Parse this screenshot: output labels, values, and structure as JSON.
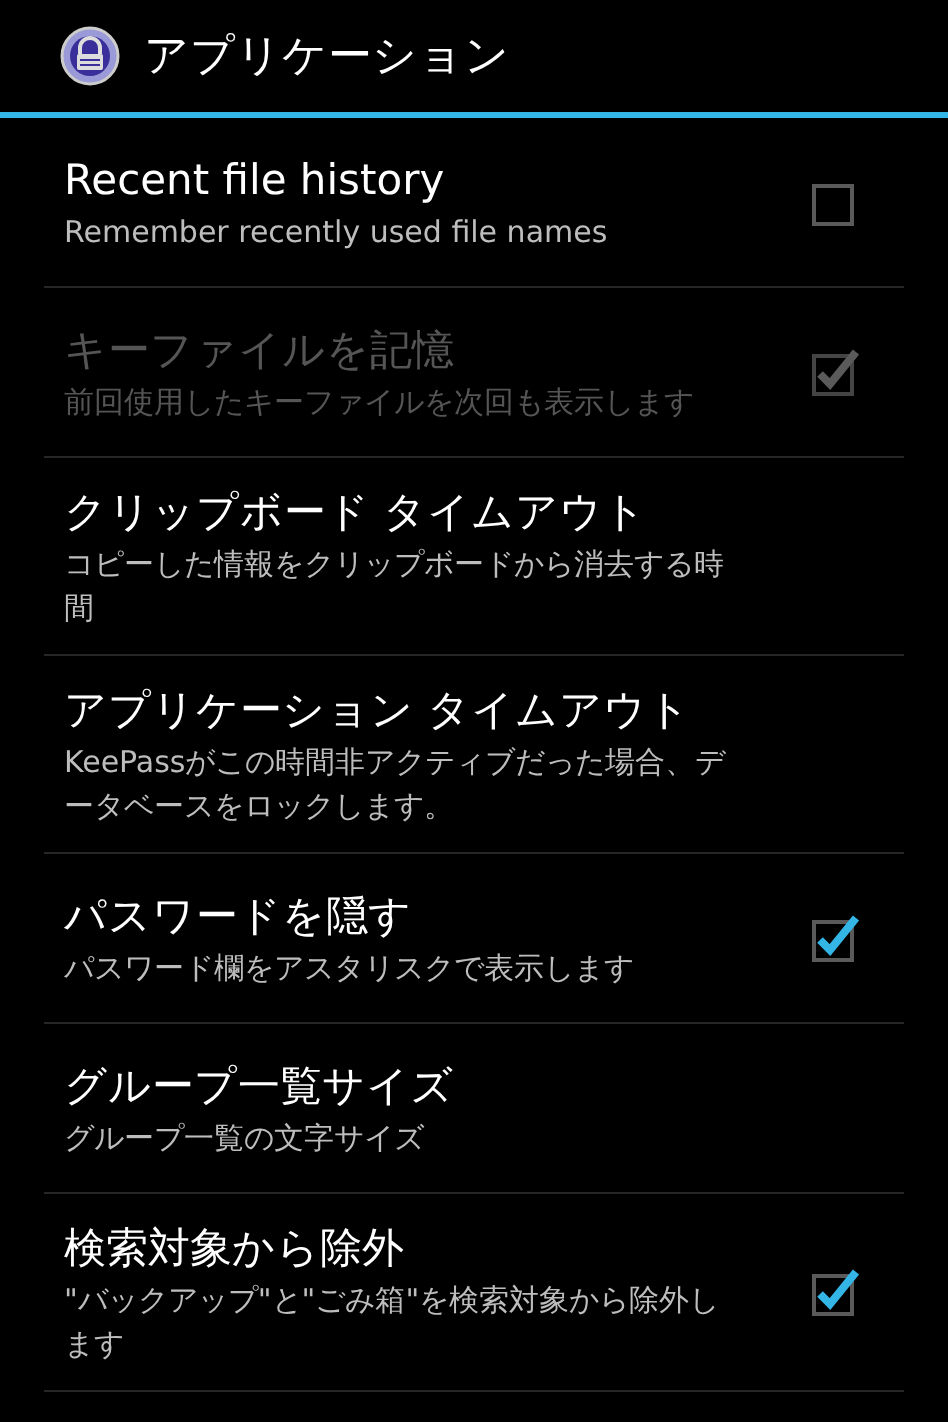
{
  "action_bar": {
    "title": "アプリケーション"
  },
  "preferences": [
    {
      "kind": "checkbox",
      "title": "Recent file history",
      "summary": "Remember recently used file names",
      "checked": false,
      "disabled": false
    },
    {
      "kind": "checkbox",
      "title": "キーファイルを記憶",
      "summary": "前回使用したキーファイルを次回も表示します",
      "checked": true,
      "disabled": true
    },
    {
      "kind": "plain",
      "title": "クリップボード タイムアウト",
      "summary": "コピーした情報をクリップボードから消去する時間",
      "disabled": false
    },
    {
      "kind": "plain",
      "title": "アプリケーション タイムアウト",
      "summary": "KeePassがこの時間非アクティブだった場合、データベースをロックします。",
      "disabled": false
    },
    {
      "kind": "checkbox",
      "title": "パスワードを隠す",
      "summary": "パスワード欄をアスタリスクで表示します",
      "checked": true,
      "disabled": false
    },
    {
      "kind": "plain",
      "title": "グループ一覧サイズ",
      "summary": "グループ一覧の文字サイズ",
      "disabled": false
    },
    {
      "kind": "checkbox",
      "title": "検索対象から除外",
      "summary": "\"バックアップ\"と\"ごみ箱\"を検索対象から除外します",
      "checked": true,
      "disabled": false
    }
  ]
}
